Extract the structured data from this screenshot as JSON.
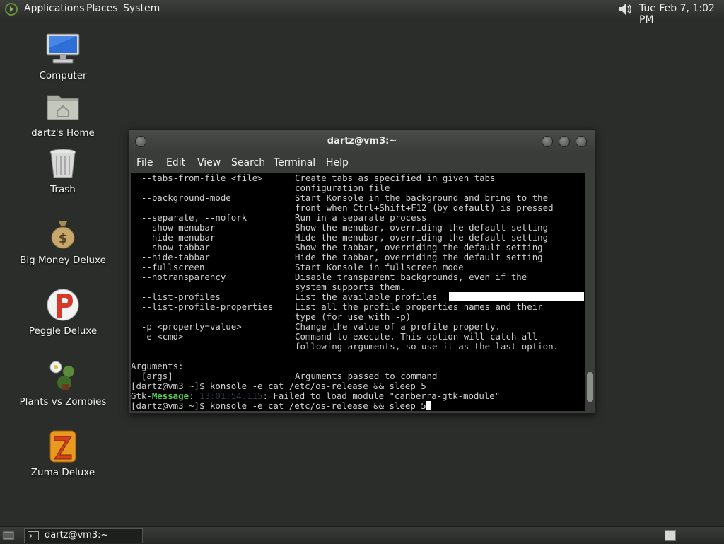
{
  "top_panel": {
    "menus": [
      "Applications",
      "Places",
      "System"
    ],
    "clock": "Tue Feb  7,  1:02 PM",
    "volume_icon": "speaker-icon"
  },
  "desktop_icons": [
    {
      "label": "Computer",
      "icon": "computer-icon"
    },
    {
      "label": "dartz's Home",
      "icon": "home-folder-icon"
    },
    {
      "label": "Trash",
      "icon": "trash-icon"
    },
    {
      "label": "Big Money Deluxe",
      "icon": "money-bag-icon"
    },
    {
      "label": "Peggle Deluxe",
      "icon": "peggle-icon"
    },
    {
      "label": "Plants vs Zombies",
      "icon": "plants-vs-zombies-icon"
    },
    {
      "label": "Zuma Deluxe",
      "icon": "zuma-icon"
    }
  ],
  "terminal": {
    "title": "dartz@vm3:~",
    "menu": [
      "File",
      "Edit",
      "View",
      "Search",
      "Terminal",
      "Help"
    ],
    "lines": [
      [
        "  --tabs-from-file <file>",
        "Create tabs as specified in given tabs"
      ],
      [
        "",
        "configuration file"
      ],
      [
        "  --background-mode",
        "Start Konsole in the background and bring to the"
      ],
      [
        "",
        "front when Ctrl+Shift+F12 (by default) is pressed"
      ],
      [
        "  --separate, --nofork",
        "Run in a separate process"
      ],
      [
        "  --show-menubar",
        "Show the menubar, overriding the default setting"
      ],
      [
        "  --hide-menubar",
        "Hide the menubar, overriding the default setting"
      ],
      [
        "  --show-tabbar",
        "Show the tabbar, overriding the default setting"
      ],
      [
        "  --hide-tabbar",
        "Hide the tabbar, overriding the default setting"
      ],
      [
        "  --fullscreen",
        "Start Konsole in fullscreen mode"
      ],
      [
        "  --notransparency",
        "Disable transparent backgrounds, even if the"
      ],
      [
        "",
        "system supports them."
      ],
      [
        "  --list-profiles",
        "List the available profiles"
      ],
      [
        "  --list-profile-properties",
        "List all the profile properties names and their"
      ],
      [
        "",
        "type (for use with -p)"
      ],
      [
        "  -p <property=value>",
        "Change the value of a profile property."
      ],
      [
        "  -e <cmd>",
        "Command to execute. This option will catch all"
      ],
      [
        "",
        "following arguments, so use it as the last option."
      ],
      [
        "",
        ""
      ],
      [
        "Arguments:",
        ""
      ],
      [
        "  [args]",
        "Arguments passed to command"
      ]
    ],
    "prompt1": "[dartz@vm3 ~]$ konsole -e cat /etc/os-release && sleep 5",
    "gtk_prefix": "Gtk-",
    "gtk_keyword": "Message",
    "gtk_colon": ": ",
    "gtk_time": "13:01:54.115",
    "gtk_rest": ": Failed to load module \"canberra-gtk-module\"",
    "prompt2": "[dartz@vm3 ~]$ konsole -e cat /etc/os-release && sleep 5"
  },
  "taskbar": {
    "task_label": "dartz@vm3:~"
  }
}
